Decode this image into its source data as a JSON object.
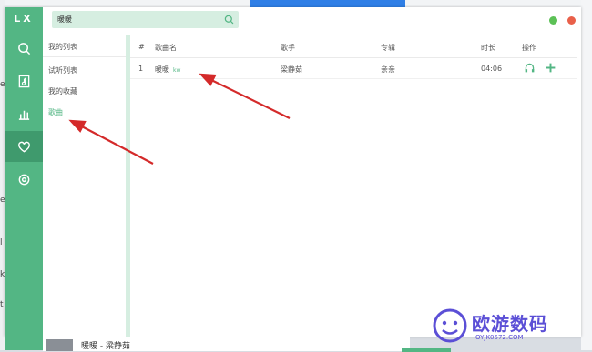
{
  "app": {
    "logo": "LX"
  },
  "search": {
    "value": "暖暖"
  },
  "colors": {
    "accent": "#53b684",
    "sidebar": "#53b684",
    "dot_min": "#5cc156",
    "dot_close": "#e9604a",
    "arrow": "#d42a2a"
  },
  "sidebar": {
    "items": [
      {
        "icon": "search-icon"
      },
      {
        "icon": "music-file-icon"
      },
      {
        "icon": "chart-icon"
      },
      {
        "icon": "heart-icon",
        "active": true
      },
      {
        "icon": "settings-icon"
      }
    ]
  },
  "lists": {
    "header": "我的列表",
    "items": [
      {
        "label": "试听列表"
      },
      {
        "label": "我的收藏"
      },
      {
        "label": "歌曲",
        "active": true
      }
    ]
  },
  "table": {
    "columns": {
      "num": "#",
      "name": "歌曲名",
      "artist": "歌手",
      "album": "专辑",
      "duration": "时长",
      "actions": "操作"
    },
    "rows": [
      {
        "num": "1",
        "name": "暖暖",
        "source": "kw",
        "artist": "梁静茹",
        "album": "亲亲",
        "duration": "04:06"
      }
    ]
  },
  "player": {
    "title": "暖暖 - 梁静茹"
  },
  "watermark": {
    "text": "欧游数码",
    "sub": "OYJK0572.COM"
  },
  "background": {
    "fragments": [
      "e",
      "e",
      "l",
      "k",
      "t"
    ]
  }
}
